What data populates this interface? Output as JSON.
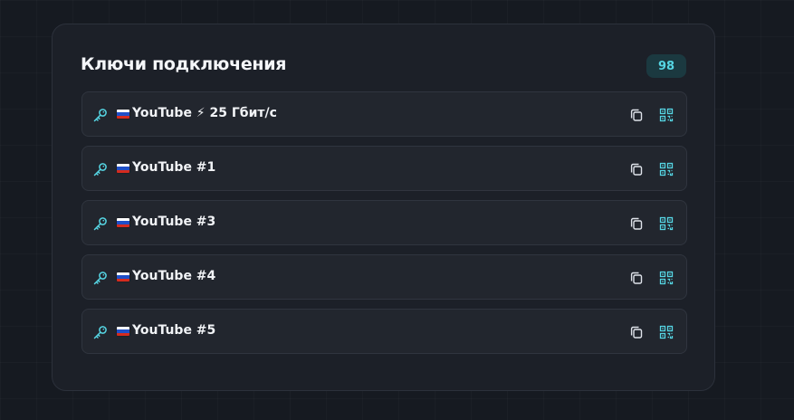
{
  "card": {
    "title": "Ключи подключения",
    "count": "98"
  },
  "flag": {
    "name": "russia-flag-icon",
    "colors": [
      "#ffffff",
      "#1f4fc8",
      "#d52b1e"
    ]
  },
  "icons": {
    "key": "key-icon",
    "copy": "copy-icon",
    "qr": "qr-code-icon"
  },
  "colors": {
    "accent": "#56d6e4",
    "background": "#161a21",
    "card": "#1c2028",
    "row": "#22262e"
  },
  "keys": [
    {
      "label": "YouTube ⚡ 25 Гбит/с"
    },
    {
      "label": "YouTube #1"
    },
    {
      "label": "YouTube #3"
    },
    {
      "label": "YouTube #4"
    },
    {
      "label": "YouTube #5"
    }
  ]
}
